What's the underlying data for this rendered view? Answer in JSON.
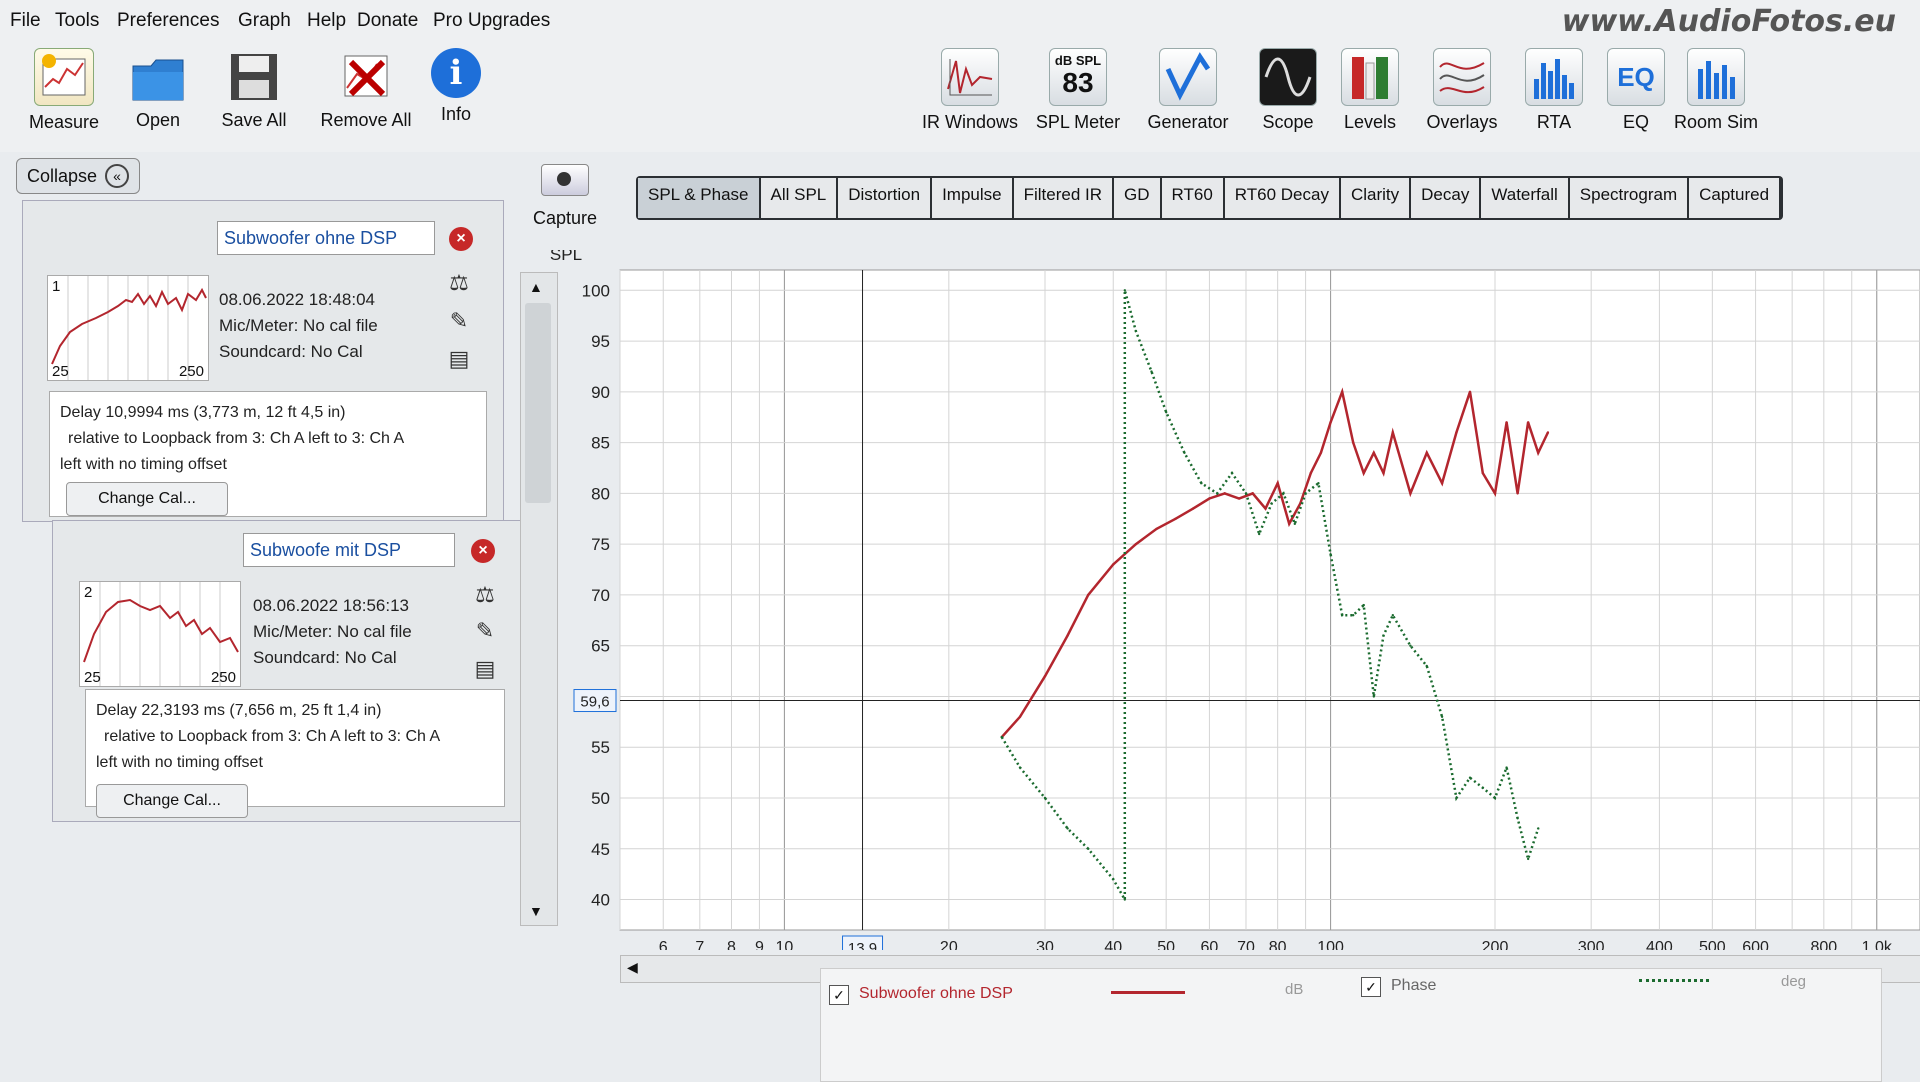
{
  "menu": [
    "File",
    "Tools",
    "Preferences",
    "Graph",
    "Help",
    "Donate",
    "Pro Upgrades"
  ],
  "watermark": "www.AudioFotos.eu",
  "toolbar_left": [
    "Measure",
    "Open",
    "Save All",
    "Remove All",
    "Info"
  ],
  "toolbar_right": [
    "IR Windows",
    "SPL Meter",
    "Generator",
    "Scope",
    "Levels",
    "Overlays",
    "RTA",
    "EQ",
    "Room Sim"
  ],
  "spl_meter_top": "dB SPL",
  "spl_meter_value": "83",
  "collapse_label": "Collapse",
  "capture_label": "Capture",
  "measurements": [
    {
      "index": "1",
      "name": "Subwoofer ohne DSP",
      "datetime": "08.06.2022 18:48:04",
      "mic": "Mic/Meter: No cal file",
      "soundcard": "Soundcard: No Cal",
      "thumb_min": "25",
      "thumb_max": "250",
      "delay": "Delay 10,9994 ms (3,773 m, 12 ft 4,5 in)",
      "relative": "relative to Loopback from 3: Ch A left to 3: Ch A",
      "offset": "left with no timing offset",
      "change_cal": "Change Cal..."
    },
    {
      "index": "2",
      "name": "Subwoofe mit DSP",
      "datetime": "08.06.2022 18:56:13",
      "mic": "Mic/Meter: No cal file",
      "soundcard": "Soundcard: No Cal",
      "thumb_min": "25",
      "thumb_max": "250",
      "delay": "Delay 22,3193 ms (7,656 m, 25 ft 1,4 in)",
      "relative": "relative to Loopback from 3: Ch A left to 3: Ch A",
      "offset": "left with no timing offset",
      "change_cal": "Change Cal..."
    }
  ],
  "tabs": [
    "SPL & Phase",
    "All SPL",
    "Distortion",
    "Impulse",
    "Filtered IR",
    "GD",
    "RT60",
    "RT60 Decay",
    "Clarity",
    "Decay",
    "Waterfall",
    "Spectrogram",
    "Captured"
  ],
  "active_tab": "SPL & Phase",
  "graph": {
    "y_axis_label": "SPL",
    "y_ticks": [
      "100",
      "95",
      "90",
      "85",
      "80",
      "75",
      "70",
      "65",
      "55",
      "50",
      "45",
      "40"
    ],
    "x_ticks": [
      "6",
      "7",
      "8",
      "9",
      "10",
      "20",
      "30",
      "40",
      "50",
      "60",
      "70",
      "80",
      "100",
      "200",
      "300",
      "400",
      "500",
      "600",
      "800",
      "1,0k"
    ],
    "cursor_x": "13,9",
    "cursor_y": "59,6"
  },
  "chart_data": {
    "type": "line",
    "xlabel": "",
    "ylabel": "SPL",
    "xscale": "log",
    "ylim": [
      37,
      102
    ],
    "series": [
      {
        "name": "Subwoofer ohne DSP",
        "color": "#b3262e",
        "style": "solid",
        "x": [
          25,
          27,
          30,
          33,
          36,
          40,
          44,
          48,
          52,
          56,
          60,
          64,
          68,
          72,
          76,
          80,
          84,
          88,
          92,
          96,
          100,
          105,
          110,
          115,
          120,
          125,
          130,
          140,
          150,
          160,
          170,
          180,
          190,
          200,
          210,
          220,
          230,
          240,
          250
        ],
        "y": [
          56,
          58,
          62,
          66,
          70,
          73,
          75,
          76.5,
          77.5,
          78.5,
          79.5,
          80,
          79.5,
          80,
          78.5,
          81,
          77,
          79,
          82,
          84,
          87,
          90,
          85,
          82,
          84,
          82,
          86,
          80,
          84,
          81,
          86,
          90,
          82,
          80,
          87,
          80,
          87,
          84,
          86
        ]
      },
      {
        "name": "Phase",
        "color": "#1b6b2f",
        "style": "dotted",
        "x": [
          25,
          27,
          30,
          33,
          36,
          40,
          42,
          42,
          44,
          47,
          50,
          54,
          58,
          62,
          66,
          70,
          74,
          78,
          82,
          86,
          90,
          95,
          100,
          105,
          110,
          115,
          120,
          125,
          130,
          140,
          150,
          160,
          170,
          180,
          190,
          200,
          210,
          220,
          230,
          240
        ],
        "y": [
          56,
          53,
          50,
          47,
          45,
          42,
          40,
          100,
          96,
          92,
          88,
          84,
          81,
          80,
          82,
          80,
          76,
          79,
          80,
          77,
          80,
          81,
          74,
          68,
          68,
          69,
          60,
          66,
          68,
          65,
          63,
          58,
          50,
          52,
          51,
          50,
          53,
          48,
          44,
          47
        ]
      }
    ]
  },
  "legend": {
    "series_label": "Subwoofer ohne DSP",
    "series_unit": "dB",
    "phase_label": "Phase",
    "phase_unit": "deg"
  }
}
